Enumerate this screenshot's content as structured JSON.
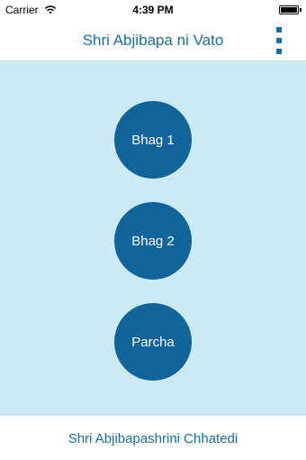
{
  "status_bar": {
    "carrier": "Carrier",
    "time": "4:39 PM",
    "wifi_icon": "wifi-icon",
    "battery_icon": "battery-icon"
  },
  "nav": {
    "title": "Shri Abjibapa ni Vato",
    "menu_icon": "vertical-dots-icon"
  },
  "buttons": [
    {
      "label": "Bhag 1"
    },
    {
      "label": "Bhag 2"
    },
    {
      "label": "Parcha"
    }
  ],
  "footer": {
    "link_label": "Shri Abjibapashrini Chhatedi"
  },
  "colors": {
    "accent": "#1a6ea6",
    "button_fill": "#0f6499",
    "content_background": "#cde9f2"
  }
}
